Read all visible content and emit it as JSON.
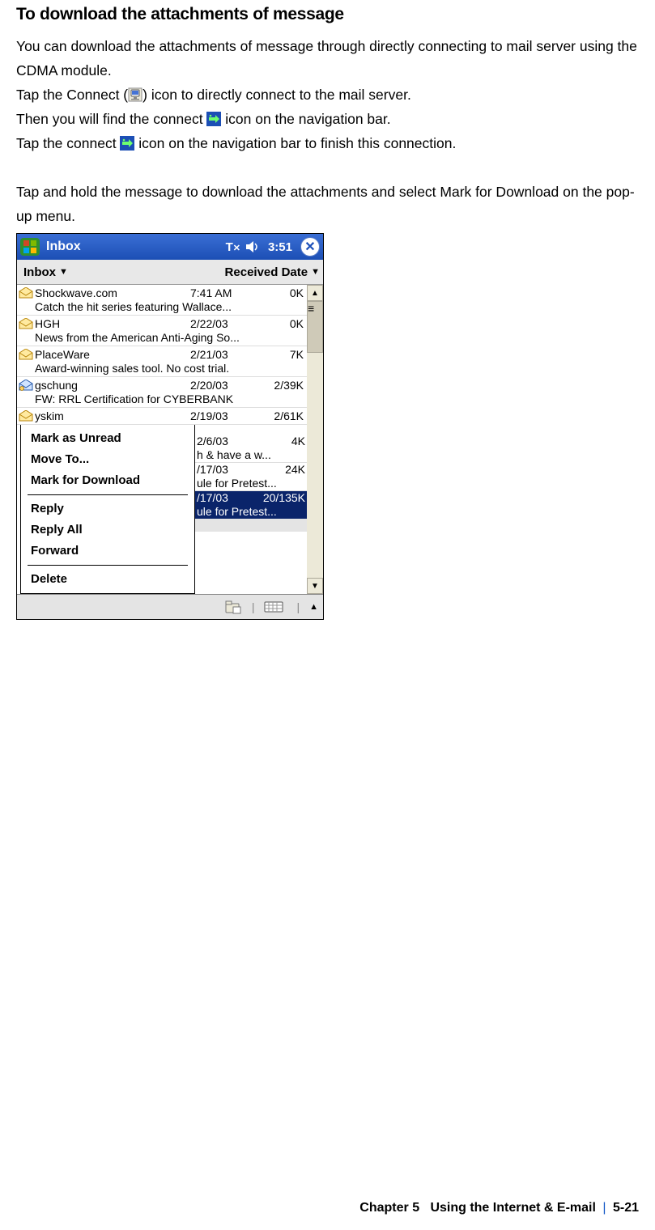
{
  "doc": {
    "title": "To download the attachments of message",
    "p1": "You can download the attachments of message through directly connecting to mail server using the CDMA module.",
    "p2a": "Tap the Connect (",
    "p2b": ") icon to directly connect to the mail server.",
    "p3a": "Then you will find the connect ",
    "p3b": " icon on the navigation bar.",
    "p4a": "Tap the connect ",
    "p4b": " icon on the navigation bar to finish this connection.",
    "p5": "Tap and hold the message to download the attachments and select Mark for Download on the pop-up menu."
  },
  "shot": {
    "title": "Inbox",
    "time": "3:51",
    "hdr_folder": "Inbox",
    "hdr_sort": "Received Date",
    "messages": [
      {
        "icon": "envelope-open",
        "from": "Shockwave.com",
        "date": "7:41 AM",
        "size": "0K",
        "subj": "Catch the hit series featuring Wallace..."
      },
      {
        "icon": "envelope-open",
        "from": "HGH",
        "date": "2/22/03",
        "size": "0K",
        "subj": "News from the American Anti-Aging So..."
      },
      {
        "icon": "envelope-open",
        "from": "PlaceWare",
        "date": "2/21/03",
        "size": "7K",
        "subj": "Award-winning sales tool. No cost trial."
      },
      {
        "icon": "envelope-attach",
        "from": "gschung",
        "date": "2/20/03",
        "size": "2/39K",
        "subj": "FW: RRL Certification for CYBERBANK"
      },
      {
        "icon": "envelope-open",
        "from": "yskim",
        "date": "2/19/03",
        "size": "2/61K",
        "subj": ""
      }
    ],
    "right_partial": [
      {
        "date": "2/6/03",
        "size": "4K",
        "subj": "h & have a w..."
      },
      {
        "date": "/17/03",
        "size": "24K",
        "subj": "ule for Pretest..."
      },
      {
        "date": "/17/03",
        "size": "20/135K",
        "subj": "ule for Pretest...",
        "selected": true
      }
    ],
    "popup": {
      "items1": [
        "Mark as Unread",
        "Move To...",
        "Mark for Download"
      ],
      "items2": [
        "Reply",
        "Reply All",
        "Forward"
      ],
      "items3": [
        "Delete"
      ]
    }
  },
  "footer": {
    "chapter": "Chapter 5",
    "title": "Using the Internet & E-mail",
    "page": "5-21"
  }
}
